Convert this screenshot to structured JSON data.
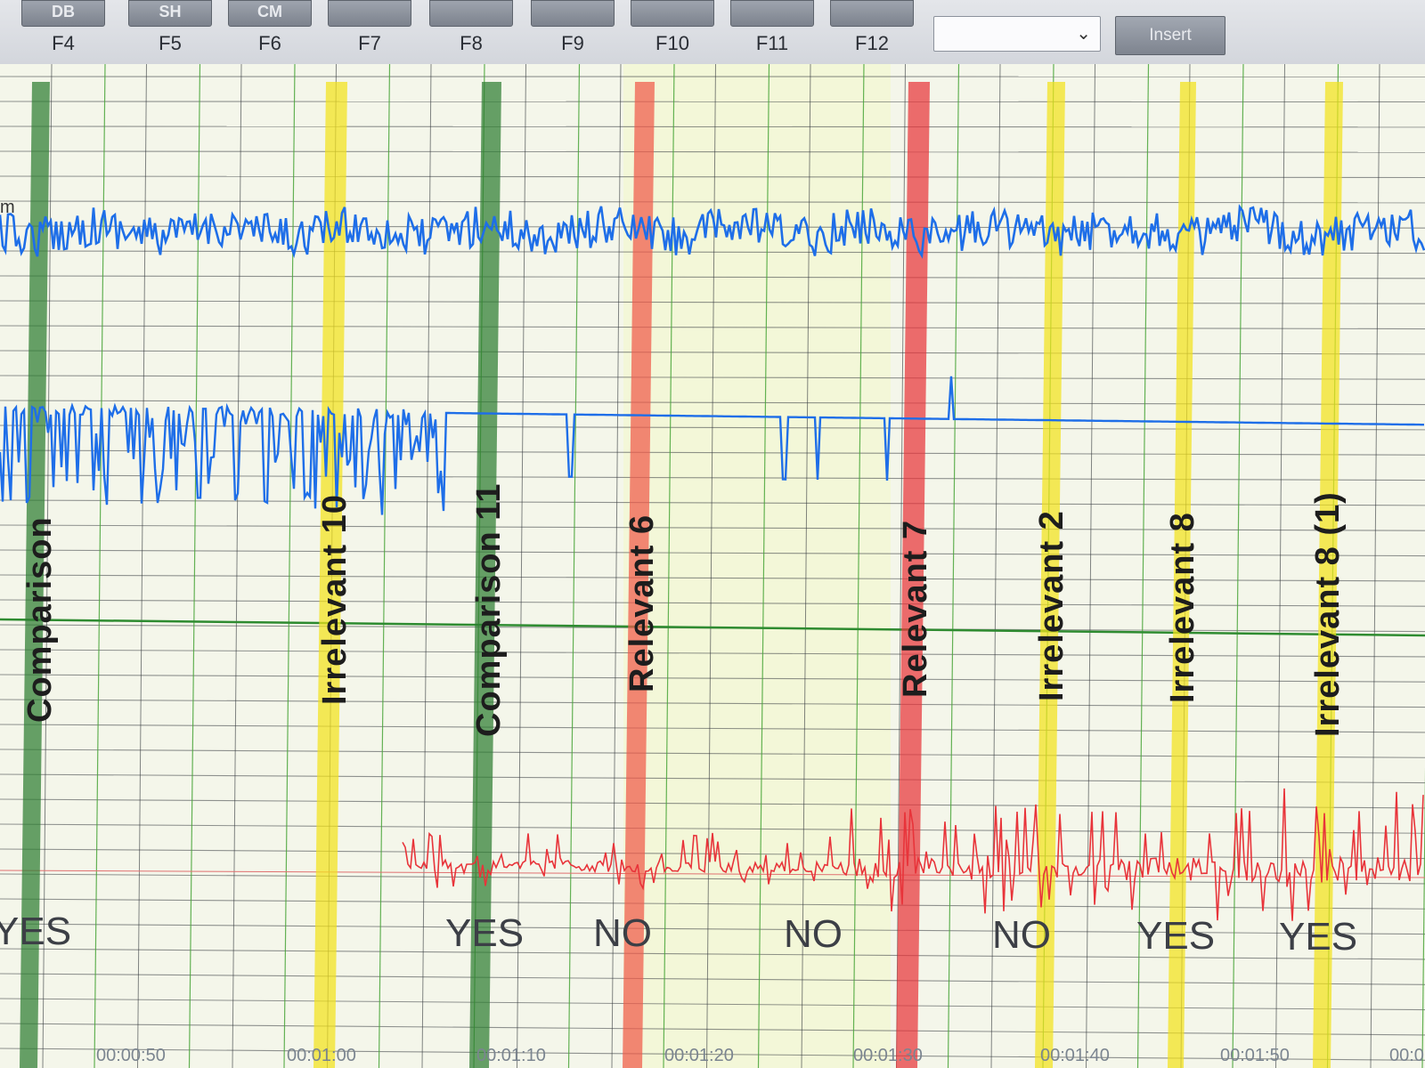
{
  "toolbar": {
    "fkeys": [
      {
        "button": "DB",
        "key": "F4"
      },
      {
        "button": "SH",
        "key": "F5"
      },
      {
        "button": "CM",
        "key": "F6"
      },
      {
        "button": "",
        "key": "F7"
      },
      {
        "button": "",
        "key": "F8"
      },
      {
        "button": "",
        "key": "F9"
      },
      {
        "button": "",
        "key": "F10"
      },
      {
        "button": "",
        "key": "F11"
      },
      {
        "button": "",
        "key": "F12"
      }
    ],
    "dropdown_value": "",
    "insert_label": "Insert"
  },
  "channel_label": "m",
  "chart_data": {
    "type": "line",
    "x_axis": {
      "unit": "time",
      "ticks": [
        "00:00:50",
        "00:01:00",
        "00:01:10",
        "00:01:20",
        "00:01:30",
        "00:01:40",
        "00:01:50",
        "00:0"
      ]
    },
    "series": [
      {
        "color": "#1e6ee8"
      },
      {
        "color": "#1e6ee8"
      },
      {
        "color": "#e8343a"
      }
    ],
    "markers": [
      {
        "label": "Comparison",
        "color": "#2e7d32",
        "answer": "YES"
      },
      {
        "label": "Irrelevant 10",
        "color": "#f2e21c",
        "answer": ""
      },
      {
        "label": "Comparison 11",
        "color": "#2e7d32",
        "answer": "YES"
      },
      {
        "label": "Relevant 6",
        "color": "#f05a4a",
        "answer": "NO"
      },
      {
        "label": "Relevant 7",
        "color": "#e8343a",
        "answer": "NO"
      },
      {
        "label": "Irrelevant 2",
        "color": "#f2e21c",
        "answer": "NO"
      },
      {
        "label": "Irrelevant 8",
        "color": "#f2e21c",
        "answer": "YES"
      },
      {
        "label": "Irrelevant 8 (1)",
        "color": "#f2e21c",
        "answer": "YES"
      }
    ],
    "grid": true
  }
}
